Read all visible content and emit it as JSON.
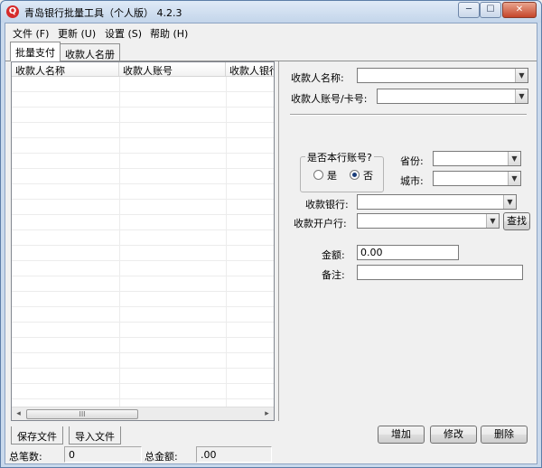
{
  "window": {
    "title": "青岛银行批量工具（个人版）  4.2.3",
    "controls": {
      "minimize": "─",
      "maximize": "☐",
      "close": "✕"
    }
  },
  "menu": [
    "文件 (F)",
    "更新 (U)",
    "设置 (S)",
    "帮助 (H)"
  ],
  "tabs": [
    {
      "label": "批量支付",
      "active": true
    },
    {
      "label": "收款人名册",
      "active": false
    }
  ],
  "list": {
    "columns": [
      "收款人名称",
      "收款人账号",
      "收款人银行"
    ],
    "scroll_thumb_glyph": "III",
    "scroll_left": "◂",
    "scroll_right": "▸"
  },
  "form": {
    "payee_name_label": "收款人名称:",
    "payee_account_label": "收款人账号/卡号:",
    "same_bank_group_title": "是否本行账号?",
    "radio_yes": "是",
    "radio_no": "否",
    "province_label": "省份:",
    "city_label": "城市:",
    "bank_label": "收款银行:",
    "branch_label": "收款开户行:",
    "search_button": "查找",
    "amount_label": "金额:",
    "amount_value": "0.00",
    "note_label": "备注:",
    "note_value": ""
  },
  "bottom_tabs": [
    "保存文件",
    "导入文件"
  ],
  "actions": {
    "add": "增加",
    "modify": "修改",
    "delete": "删除"
  },
  "status": {
    "count_label": "总笔数:",
    "count_value": "0",
    "total_label": "总金额:",
    "total_value": ".00"
  },
  "dropdown_arrow": "▼"
}
